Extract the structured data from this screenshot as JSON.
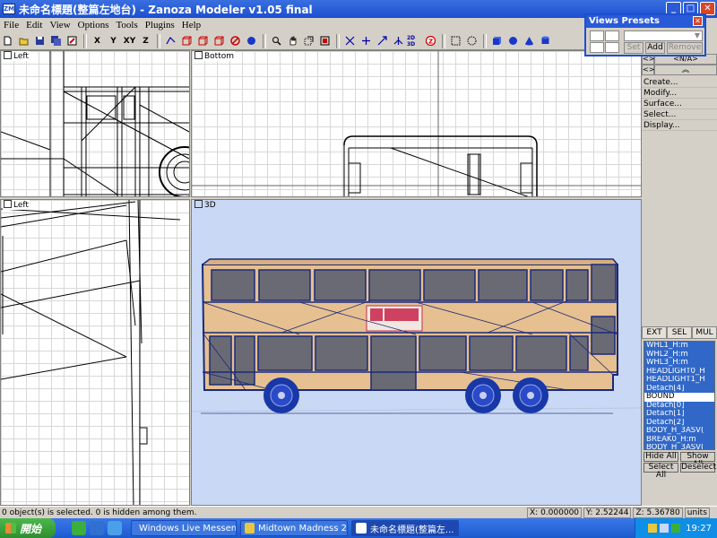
{
  "window": {
    "title": "未命名標題(整篇左地台) - Zanoza Modeler v1.05 final",
    "icon_text": "ZM"
  },
  "menu": [
    "File",
    "Edit",
    "View",
    "Options",
    "Tools",
    "Plugins",
    "Help"
  ],
  "toolbar": {
    "axis_x": "X",
    "axis_y": "Y",
    "axis_xy": "XY",
    "axis_z": "Z",
    "btn_2d3d": "2D 3D",
    "btn_z": "Z"
  },
  "viewports": {
    "top_left": "Left",
    "top_right": "Bottom",
    "bottom_left": "Left",
    "bottom_right": "3D"
  },
  "views_presets": {
    "title": "Views Presets",
    "set": "Set",
    "add": "Add",
    "remove": "Remove"
  },
  "right_panel": {
    "na_label": "<N/A>",
    "left_arrow": "<>",
    "expand": "︽",
    "buttons": [
      "Create...",
      "Modify...",
      "Surface...",
      "Select...",
      "Display..."
    ]
  },
  "tabs": [
    "EXT",
    "SEL",
    "MUL"
  ],
  "object_list": [
    {
      "name": "WHL1_H:m",
      "selected": true
    },
    {
      "name": "WHL2_H:m",
      "selected": true
    },
    {
      "name": "WHL3_H:m",
      "selected": true
    },
    {
      "name": "HEADLIGHT0_H",
      "selected": true
    },
    {
      "name": "HEADLIGHT1_H",
      "selected": true
    },
    {
      "name": "Detach[4]",
      "selected": true
    },
    {
      "name": "BOUND",
      "selected": false
    },
    {
      "name": "Detach[0]",
      "selected": true
    },
    {
      "name": "Detach[1]",
      "selected": true
    },
    {
      "name": "Detach[2]",
      "selected": true
    },
    {
      "name": "BODY_H_3ASV(",
      "selected": true
    },
    {
      "name": "BREAK0_H:m",
      "selected": true
    },
    {
      "name": "BODY_H_3ASV(",
      "selected": true
    }
  ],
  "list_buttons": {
    "hide_all": "Hide All",
    "show_all": "Show All",
    "select_all": "Select All",
    "deselect": "Deselect"
  },
  "status": {
    "message": "0 object(s) is selected. 0 is hidden among them.",
    "x_label": "X:",
    "x": "0.000000",
    "y_label": "Y:",
    "y": "2.52244",
    "z_label": "Z:",
    "z": "5.36780",
    "units": "units"
  },
  "taskbar": {
    "start": "開始",
    "tasks": [
      {
        "label": "Windows Live Messen...",
        "active": false
      },
      {
        "label": "Midtown Madness 2",
        "active": false
      },
      {
        "label": "未命名標題(整篇左...",
        "active": true
      }
    ],
    "clock": "19:27"
  },
  "colors": {
    "title_blue": "#1c4fd0",
    "viewport_3d_bg": "#c9d8f4",
    "bus_cream": "#e6c090",
    "bus_navy": "#1a2a7a",
    "list_selected": "#3168c8"
  }
}
